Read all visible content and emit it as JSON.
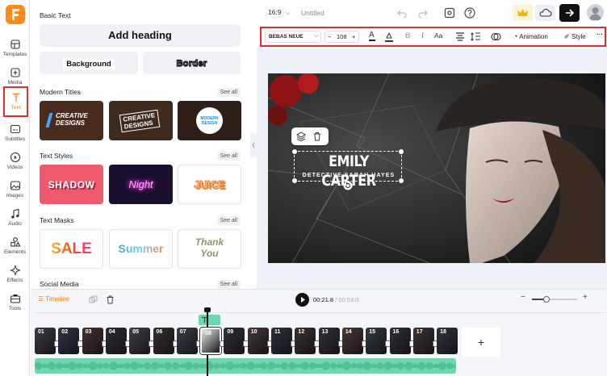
{
  "colors": {
    "accent": "#ff7a1a",
    "highlight": "#e0302a",
    "brand": "#ff8a1e",
    "audio": "#6fd6ad"
  },
  "rail": [
    {
      "id": "templates",
      "label": "Templates",
      "icon": "templates-icon"
    },
    {
      "id": "media",
      "label": "Media",
      "icon": "media-icon"
    },
    {
      "id": "text",
      "label": "Text",
      "icon": "text-icon",
      "active": true
    },
    {
      "id": "subtitles",
      "label": "Subtitles",
      "icon": "subtitles-icon"
    },
    {
      "id": "videos",
      "label": "Videos",
      "icon": "videos-icon"
    },
    {
      "id": "images",
      "label": "Images",
      "icon": "images-icon"
    },
    {
      "id": "audio",
      "label": "Audio",
      "icon": "audio-icon"
    },
    {
      "id": "elements",
      "label": "Elements",
      "icon": "elements-icon"
    },
    {
      "id": "effects",
      "label": "Effects",
      "icon": "effects-icon"
    },
    {
      "id": "tools",
      "label": "Tools",
      "icon": "tools-icon"
    }
  ],
  "panel": {
    "basic_text_title": "Basic Text",
    "add_heading": "Add heading",
    "background": "Background",
    "border": "Border",
    "see_all": "See all",
    "sections": {
      "modern_titles": "Modern Titles",
      "text_styles": "Text Styles",
      "text_masks": "Text Masks",
      "social_media": "Social Media"
    },
    "modern_tiles": [
      {
        "line1": "CREATIVE",
        "line2": "DESIGNS"
      },
      {
        "line1": "CREATIVE",
        "line2": "DESIGNS"
      },
      {
        "line1": "MODERN",
        "line2": "DESIGN"
      }
    ],
    "style_tiles": [
      "SHADOW",
      "Night",
      "JUICE"
    ],
    "mask_tiles": [
      "SALE",
      "Summer",
      "Thank",
      "You"
    ]
  },
  "topbar": {
    "aspect": "16:9",
    "title": "Untitled"
  },
  "toolbar": {
    "font": "BEBAS NEUE",
    "size": "108",
    "minus": "−",
    "plus": "+",
    "case": "Aa",
    "animation": "Animation",
    "style": "Style",
    "more": "···"
  },
  "canvas": {
    "title": "EMILY CARTER",
    "subtitle": "DETECTIVE SARAH HAYES"
  },
  "timeline": {
    "label": "Timeline",
    "current_time": "00:21.8",
    "separator": "/",
    "total_time": "00:53.0",
    "add": "+",
    "zoom_minus": "−",
    "zoom_plus": "+",
    "selected": "08",
    "clips": [
      "01",
      "02",
      "03",
      "04",
      "05",
      "06",
      "07",
      "08",
      "09",
      "10",
      "11",
      "12",
      "13",
      "14",
      "15",
      "16",
      "17",
      "18"
    ]
  }
}
